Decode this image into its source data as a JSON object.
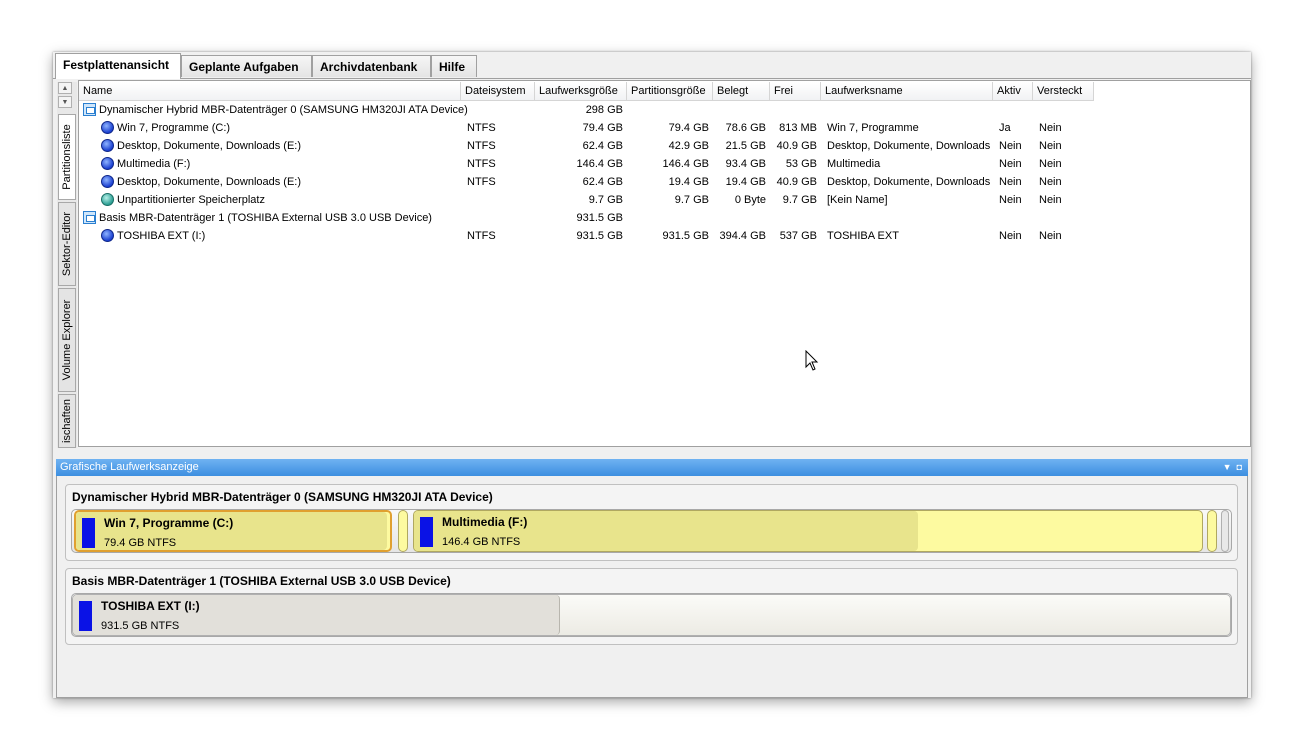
{
  "tabs": [
    "Festplattenansicht",
    "Geplante Aufgaben",
    "Archivdatenbank",
    "Hilfe"
  ],
  "side_tabs": [
    "Partitionsliste",
    "Sektor-Editor",
    "Volume Explorer",
    "ischaften"
  ],
  "columns": [
    "Name",
    "Dateisystem",
    "Laufwerksgröße",
    "Partitionsgröße",
    "Belegt",
    "Frei",
    "Laufwerksname",
    "Aktiv",
    "Versteckt"
  ],
  "rows": [
    {
      "type": "disk",
      "name": "Dynamischer Hybrid MBR-Datenträger 0 (SAMSUNG HM320JI ATA Device)",
      "fs": "",
      "drive_size": "298 GB",
      "part_size": "",
      "used": "",
      "free": "",
      "label": "",
      "active": "",
      "hidden": ""
    },
    {
      "type": "part",
      "name": "Win 7, Programme (C:)",
      "fs": "NTFS",
      "drive_size": "79.4 GB",
      "part_size": "79.4 GB",
      "used": "78.6 GB",
      "free": "813 MB",
      "label": "Win 7, Programme",
      "active": "Ja",
      "hidden": "Nein"
    },
    {
      "type": "part",
      "name": "Desktop, Dokumente, Downloads (E:)",
      "fs": "NTFS",
      "drive_size": "62.4 GB",
      "part_size": "42.9 GB",
      "used": "21.5 GB",
      "free": "40.9 GB",
      "label": "Desktop, Dokumente, Downloads",
      "active": "Nein",
      "hidden": "Nein"
    },
    {
      "type": "part",
      "name": "Multimedia (F:)",
      "fs": "NTFS",
      "drive_size": "146.4 GB",
      "part_size": "146.4 GB",
      "used": "93.4 GB",
      "free": "53 GB",
      "label": "Multimedia",
      "active": "Nein",
      "hidden": "Nein"
    },
    {
      "type": "part",
      "name": "Desktop, Dokumente, Downloads (E:)",
      "fs": "NTFS",
      "drive_size": "62.4 GB",
      "part_size": "19.4 GB",
      "used": "19.4 GB",
      "free": "40.9 GB",
      "label": "Desktop, Dokumente, Downloads",
      "active": "Nein",
      "hidden": "Nein"
    },
    {
      "type": "unp",
      "name": "Unpartitionierter Speicherplatz",
      "fs": "",
      "drive_size": "9.7 GB",
      "part_size": "9.7 GB",
      "used": "0 Byte",
      "free": "9.7 GB",
      "label": "[Kein Name]",
      "active": "Nein",
      "hidden": "Nein"
    },
    {
      "type": "disk",
      "name": "Basis MBR-Datenträger 1 (TOSHIBA External USB 3.0 USB Device)",
      "fs": "",
      "drive_size": "931.5 GB",
      "part_size": "",
      "used": "",
      "free": "",
      "label": "",
      "active": "",
      "hidden": ""
    },
    {
      "type": "part",
      "name": "TOSHIBA EXT (I:)",
      "fs": "NTFS",
      "drive_size": "931.5 GB",
      "part_size": "931.5 GB",
      "used": "394.4 GB",
      "free": "537 GB",
      "label": "TOSHIBA EXT",
      "active": "Nein",
      "hidden": "Nein"
    }
  ],
  "graphic": {
    "title": "Grafische Laufwerksanzeige",
    "disks": [
      {
        "title": "Dynamischer Hybrid MBR-Datenträger 0 (SAMSUNG HM320JI ATA Device)",
        "partitions": [
          {
            "name": "Win 7, Programme (C:)",
            "size": "79.4 GB NTFS",
            "used_fraction": 0.99,
            "selected": true
          },
          {
            "name": "Multimedia (F:)",
            "size": "146.4 GB NTFS",
            "used_fraction": 0.64,
            "selected": false
          }
        ]
      },
      {
        "title": "Basis MBR-Datenträger 1 (TOSHIBA External USB 3.0 USB Device)",
        "partitions": [
          {
            "name": "TOSHIBA EXT (I:)",
            "size": "931.5 GB NTFS",
            "used_fraction": 0.42,
            "selected": false
          }
        ]
      }
    ]
  },
  "colors": {
    "partition_color": "#0a12e6",
    "fat_yellow": "#fdfaa0",
    "used_yellow": "#e8e48c",
    "header_blue": "#3d8fe0"
  }
}
